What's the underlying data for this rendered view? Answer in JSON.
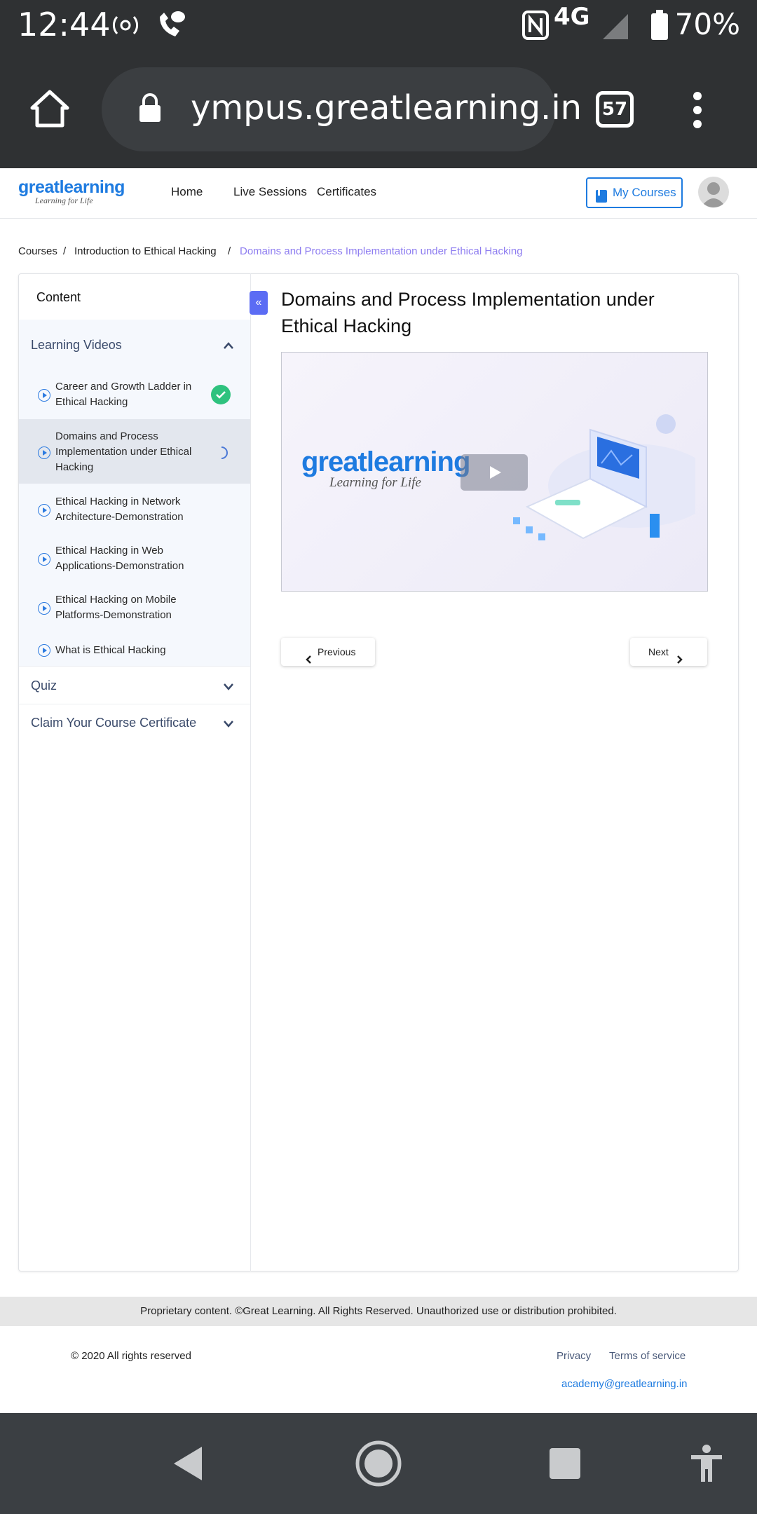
{
  "status_bar": {
    "time": "12:44",
    "network": "4G",
    "battery": "70%"
  },
  "browser": {
    "url": "ympus.greatlearning.in",
    "tab_count": "57"
  },
  "header": {
    "logo_main": "greatlearning",
    "logo_tagline": "Learning for Life",
    "nav": [
      "Home",
      "Live Sessions",
      "Certificates"
    ],
    "my_courses": "My Courses"
  },
  "breadcrumb": {
    "items": [
      "Courses",
      "Introduction to Ethical Hacking",
      "Domains and Process Implementation under Ethical Hacking"
    ],
    "separator": "/"
  },
  "sidebar": {
    "heading": "Content",
    "sections": [
      {
        "title": "Learning Videos",
        "expanded": true
      },
      {
        "title": "Quiz",
        "expanded": false
      },
      {
        "title": "Claim Your Course Certificate",
        "expanded": false
      }
    ],
    "items": [
      {
        "label": "Career and Growth Ladder in Ethical Hacking",
        "status": "completed"
      },
      {
        "label": "Domains and Process Implementation under Ethical Hacking",
        "status": "in-progress"
      },
      {
        "label": "Ethical Hacking in Network Architecture-Demonstration",
        "status": "not-started"
      },
      {
        "label": "Ethical Hacking in Web Applications-Demonstration",
        "status": "not-started"
      },
      {
        "label": "Ethical Hacking on Mobile Platforms-Demonstration",
        "status": "not-started"
      },
      {
        "label": "What is Ethical Hacking",
        "status": "not-started"
      }
    ]
  },
  "main": {
    "title": "Domains and Process Implementation under Ethical Hacking",
    "video": {
      "logo_main": "greatlearning",
      "logo_tagline": "Learning for Life"
    },
    "previous_label": "Previous",
    "next_label": "Next"
  },
  "footer": {
    "proprietary": "Proprietary content. ©Great Learning. All Rights Reserved. Unauthorized use or distribution prohibited.",
    "copyright": "© 2020 All rights reserved",
    "privacy": "Privacy",
    "terms": "Terms of service",
    "email": "academy@greatlearning.in"
  },
  "colors": {
    "accent": "#1e7be0",
    "collapse_button": "#5b6cf4",
    "completed": "#2ec27e",
    "breadcrumb_active": "#8d7cf0"
  }
}
